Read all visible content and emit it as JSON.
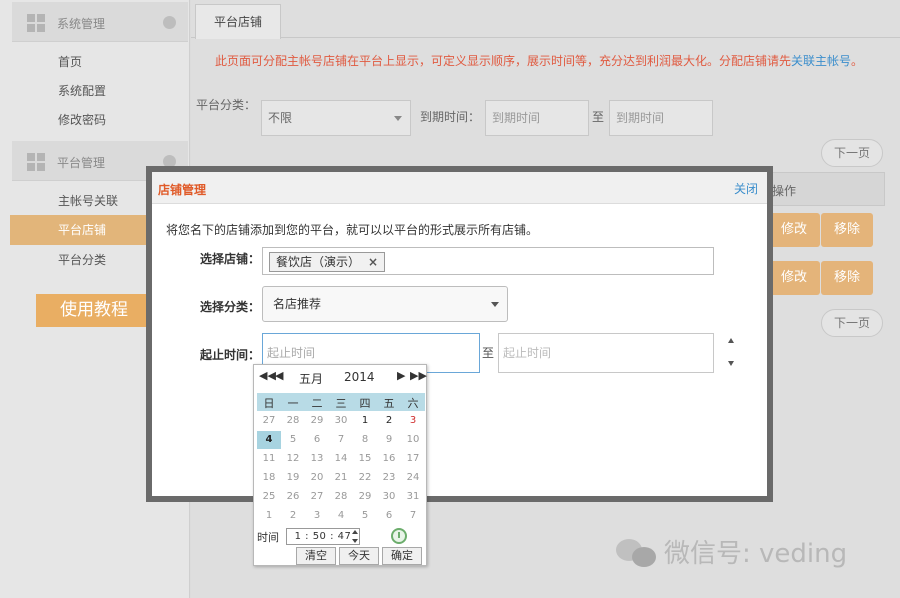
{
  "sidebar": {
    "sections": [
      {
        "title": "系统管理",
        "icon": "grid-icon"
      },
      {
        "title": "平台管理",
        "icon": "grid-icon"
      }
    ],
    "items": [
      {
        "label": "首页",
        "active": false
      },
      {
        "label": "系统配置",
        "active": false
      },
      {
        "label": "修改密码",
        "active": false
      },
      {
        "label": "主帐号关联",
        "active": false
      },
      {
        "label": "平台店铺",
        "active": true
      },
      {
        "label": "平台分类",
        "active": false
      }
    ],
    "tutorial_button": "使用教程"
  },
  "main": {
    "tab": "平台店铺",
    "notice": "此页面可分配主帐号店铺在平台上显示，可定义显示顺序，展示时间等，充分达到利润最大化。分配店铺请先",
    "notice_link": "关联主帐号",
    "notice_end": "。",
    "filter": {
      "category_label": "平台分类：",
      "category_value": "不限",
      "expire_label": "到期时间：",
      "expire_start_placeholder": "到期时间",
      "separator": "至",
      "expire_end_placeholder": "到期时间"
    },
    "pager_next": "下一页",
    "table_head_operate": "操作",
    "row_buttons": {
      "edit": "修改",
      "remove": "移除"
    }
  },
  "modal": {
    "title": "店铺管理",
    "close": "关闭",
    "description": "将您名下的店铺添加到您的平台，就可以以平台的形式展示所有店铺。",
    "store_label": "选择店铺：",
    "store_tag": "餐饮店（演示）",
    "store_tag_remove": "×",
    "category_label": "选择分类：",
    "category_value": "名店推荐",
    "date_label": "起止时间：",
    "date_start_placeholder": "起止时间",
    "date_separator": "至",
    "date_end_placeholder": "起止时间"
  },
  "calendar": {
    "month": "五月",
    "year": "2014",
    "weekdays": [
      "日",
      "一",
      "二",
      "三",
      "四",
      "五",
      "六"
    ],
    "weeks": [
      [
        "27",
        "28",
        "29",
        "30",
        "1",
        "2",
        "3"
      ],
      [
        "4",
        "5",
        "6",
        "7",
        "8",
        "9",
        "10"
      ],
      [
        "11",
        "12",
        "13",
        "14",
        "15",
        "16",
        "17"
      ],
      [
        "18",
        "19",
        "20",
        "21",
        "22",
        "23",
        "24"
      ],
      [
        "25",
        "26",
        "27",
        "28",
        "29",
        "30",
        "31"
      ],
      [
        "1",
        "2",
        "3",
        "4",
        "5",
        "6",
        "7"
      ]
    ],
    "selected_day": "4",
    "time_label": "时间",
    "time_value": "1 : 50 : 47",
    "buttons": {
      "clear": "清空",
      "today": "今天",
      "confirm": "确定"
    }
  },
  "watermark": "微信号: veding"
}
